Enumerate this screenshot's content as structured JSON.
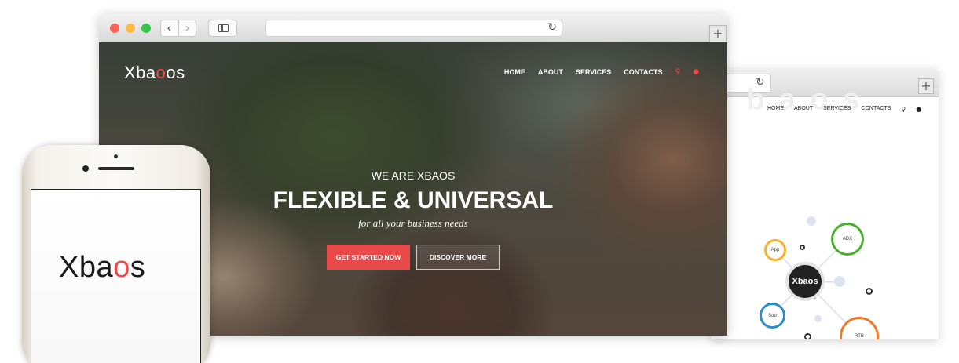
{
  "main_browser": {
    "nav": {
      "back_icon": "‹",
      "forward_icon": "›",
      "reload_icon": "↻",
      "new_tab_icon": "+"
    }
  },
  "site": {
    "logo": {
      "prefix": "Xb",
      "accent": "o",
      "suffix": "os",
      "a_char": "a"
    },
    "menu": [
      "HOME",
      "ABOUT",
      "SERVICES",
      "CONTACTS"
    ],
    "search_icon": "⚲",
    "user_icon": "●",
    "accent_color": "#e84a4a",
    "hero": {
      "eyebrow": "WE ARE XBAOS",
      "headline": "FLEXIBLE & UNIVERSAL",
      "tagline": "for all your business needs",
      "primary_button": "GET STARTED NOW",
      "secondary_button": "DISCOVER MORE"
    }
  },
  "secondary_browser": {
    "reload_icon": "↻",
    "new_tab_icon": "+",
    "menu": [
      "HOME",
      "ABOUT",
      "SERVICES",
      "CONTACTS"
    ],
    "search_icon": "⚲",
    "user_icon": "●",
    "diagram": {
      "center": "Xbaos",
      "nodes": [
        "App",
        "ADX",
        "Sub",
        "RTB"
      ]
    }
  },
  "phone": {
    "logo": "Xbaos"
  }
}
